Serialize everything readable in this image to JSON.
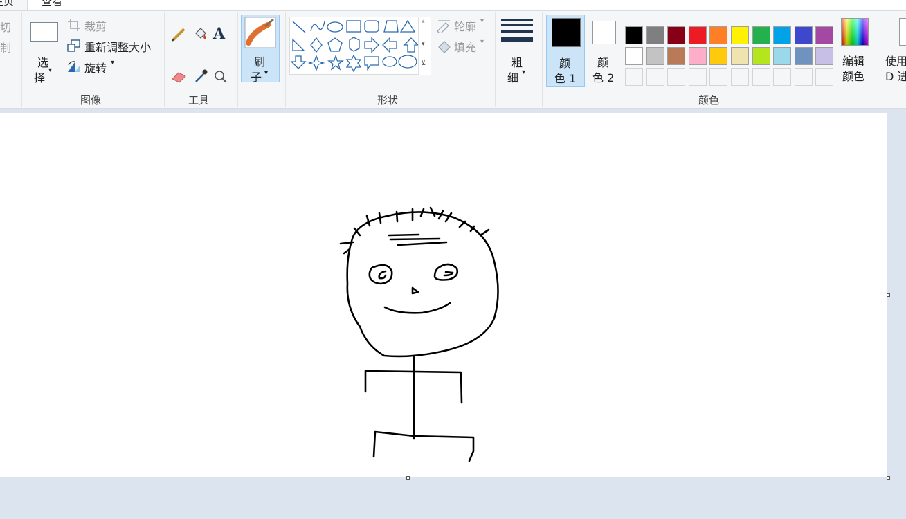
{
  "tabs": [
    "主页",
    "查看"
  ],
  "clipboard": {
    "cut_label": "切",
    "copy_label": "制"
  },
  "image": {
    "group_label": "图像",
    "select_label_1": "选",
    "select_label_2": "择",
    "crop_label": "裁剪",
    "resize_label": "重新调整大小",
    "rotate_label": "旋转"
  },
  "tools": {
    "group_label": "工具"
  },
  "brushes": {
    "label_1": "刷",
    "label_2": "子"
  },
  "shapes": {
    "group_label": "形状",
    "outline_label": "轮廓",
    "fill_label": "填充"
  },
  "size": {
    "label_1": "粗",
    "label_2": "细"
  },
  "colors": {
    "group_label": "颜色",
    "color1_label_1": "颜",
    "color1_label_2": "色 1",
    "color2_label_1": "颜",
    "color2_label_2": "色 2",
    "edit_label_1": "编辑",
    "edit_label_2": "颜色",
    "color1_value": "#000000",
    "color2_value": "#ffffff",
    "palette_row1": [
      "#000000",
      "#7f7f7f",
      "#880015",
      "#ed1c24",
      "#ff7f27",
      "#fff200",
      "#22b14c",
      "#00a2e8",
      "#3f48cc",
      "#a349a4"
    ],
    "palette_row2": [
      "#ffffff",
      "#c3c3c3",
      "#b97a57",
      "#ffaec9",
      "#ffc90e",
      "#efe4b0",
      "#b5e61d",
      "#99d9ea",
      "#7092be",
      "#c8bfe7"
    ]
  },
  "paint3d": {
    "label_1": "使用",
    "label_2": "D 进"
  }
}
